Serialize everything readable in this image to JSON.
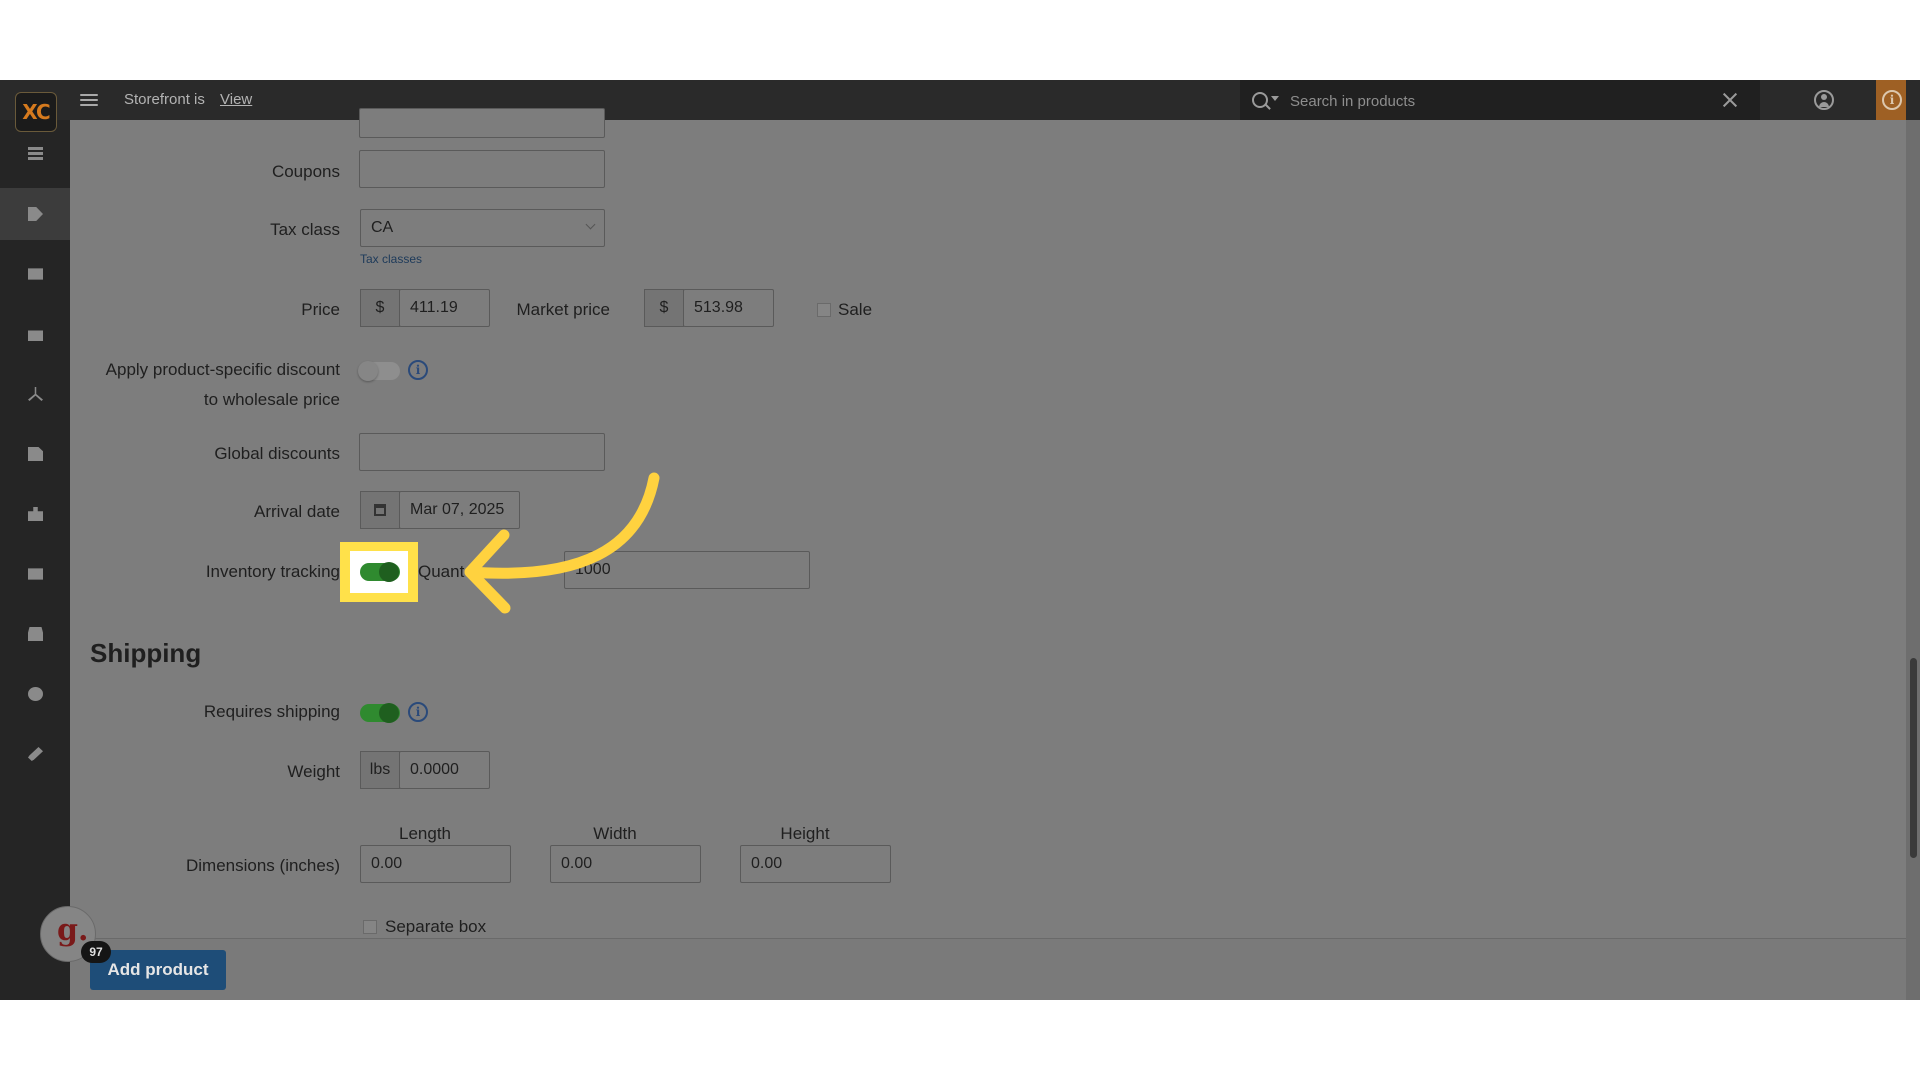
{
  "topbar": {
    "logo_text": "XC",
    "storefront_label": "Storefront is",
    "view_link": "View",
    "search_placeholder": "Search in products"
  },
  "sidebar": {
    "items": [
      {
        "icon": "orders-list-icon",
        "active": false
      },
      {
        "icon": "tag-icon",
        "active": true
      },
      {
        "icon": "mail-icon",
        "active": false
      },
      {
        "icon": "gift-icon",
        "active": false
      },
      {
        "icon": "network-icon",
        "active": false
      },
      {
        "icon": "document-icon",
        "active": false
      },
      {
        "icon": "puzzle-icon",
        "active": false
      },
      {
        "icon": "image-icon",
        "active": false
      },
      {
        "icon": "store-icon",
        "active": false
      },
      {
        "icon": "gear-icon",
        "active": false
      },
      {
        "icon": "wrench-icon",
        "active": false
      }
    ]
  },
  "form": {
    "coupons_label": "Coupons",
    "coupons_value": "",
    "tax_class_label": "Tax class",
    "tax_class_value": "CA",
    "tax_classes_link": "Tax classes",
    "price_label": "Price",
    "price_currency": "$",
    "price_value": "411.19",
    "market_price_label": "Market price",
    "market_currency": "$",
    "market_price_value": "513.98",
    "sale_label": "Sale",
    "discount_label_line1": "Apply product-specific discount",
    "discount_label_line2": "to wholesale price",
    "discount_enabled": false,
    "global_discounts_label": "Global discounts",
    "global_discounts_value": "",
    "arrival_date_label": "Arrival date",
    "arrival_date_value": "Mar 07, 2025",
    "inventory_label": "Inventory tracking",
    "inventory_enabled": true,
    "quantity_label": "Quant",
    "quantity_value": "1000"
  },
  "shipping": {
    "title": "Shipping",
    "requires_label": "Requires shipping",
    "requires_enabled": true,
    "weight_label": "Weight",
    "weight_unit": "lbs",
    "weight_value": "0.0000",
    "dimensions_label": "Dimensions (inches)",
    "length_label": "Length",
    "width_label": "Width",
    "height_label": "Height",
    "length_value": "0.00",
    "width_value": "0.00",
    "height_value": "0.00",
    "separate_box_label": "Separate box"
  },
  "footer": {
    "add_product_label": "Add product",
    "g_letter": "g.",
    "badge_count": "97"
  },
  "colors": {
    "highlight": "#ffe14a",
    "arrow": "#ffd23f",
    "toggle_on": "#2f8a2f",
    "button": "#1e4d78"
  }
}
